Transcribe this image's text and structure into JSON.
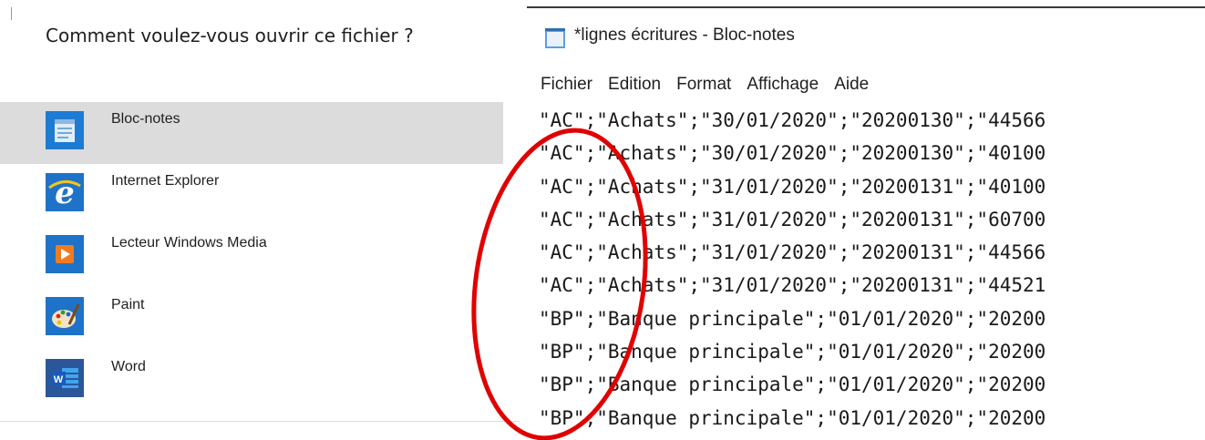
{
  "open_with": {
    "title": "Comment voulez-vous ouvrir ce fichier ?",
    "apps": [
      {
        "label": "Bloc-notes",
        "icon": "notepad-icon",
        "selected": true
      },
      {
        "label": "Internet Explorer",
        "icon": "internet-explorer-icon",
        "selected": false
      },
      {
        "label": "Lecteur Windows Media",
        "icon": "windows-media-player-icon",
        "selected": false
      },
      {
        "label": "Paint",
        "icon": "paint-icon",
        "selected": false
      },
      {
        "label": "Word",
        "icon": "word-icon",
        "selected": false
      }
    ]
  },
  "notepad": {
    "title": "*lignes écritures - Bloc-notes",
    "menu": [
      "Fichier",
      "Edition",
      "Format",
      "Affichage",
      "Aide"
    ],
    "lines": [
      "\"AC\";\"Achats\";\"30/01/2020\";\"20200130\";\"44566",
      "\"AC\";\"Achats\";\"30/01/2020\";\"20200130\";\"40100",
      "\"AC\";\"Achats\";\"31/01/2020\";\"20200131\";\"40100",
      "\"AC\";\"Achats\";\"31/01/2020\";\"20200131\";\"60700",
      "\"AC\";\"Achats\";\"31/01/2020\";\"20200131\";\"44566",
      "\"AC\";\"Achats\";\"31/01/2020\";\"20200131\";\"44521",
      "\"BP\";\"Banque principale\";\"01/01/2020\";\"20200",
      "\"BP\";\"Banque principale\";\"01/01/2020\";\"20200",
      "\"BP\";\"Banque principale\";\"01/01/2020\";\"20200",
      "\"BP\";\"Banque principale\";\"01/01/2020\";\"20200"
    ]
  },
  "colors": {
    "selection": "#dcdcdc",
    "annotation": "#e00000",
    "ie_blue": "#1e73c8",
    "word_blue": "#2b579a",
    "wmp_orange": "#f07b1f"
  }
}
